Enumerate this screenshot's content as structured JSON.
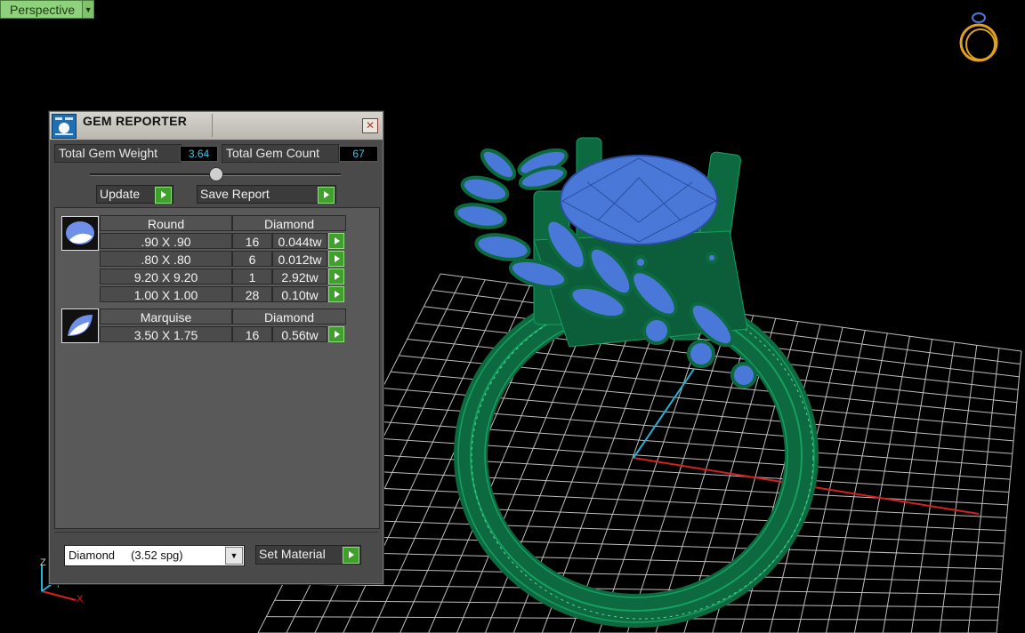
{
  "viewport": {
    "view_label": "Perspective",
    "axis_labels": {
      "z": "Z",
      "y": "Y",
      "x": "X"
    }
  },
  "panel": {
    "title": "GEM REPORTER",
    "total_weight_label": "Total Gem Weight",
    "total_weight_value": "3.64",
    "total_count_label": "Total Gem Count",
    "total_count_value": "67",
    "update_label": "Update",
    "save_report_label": "Save Report",
    "groups": [
      {
        "shape": "Round",
        "material": "Diamond",
        "rows": [
          {
            "size": ".90 X .90",
            "count": "16",
            "weight": "0.044tw"
          },
          {
            "size": ".80 X .80",
            "count": "6",
            "weight": "0.012tw"
          },
          {
            "size": "9.20 X 9.20",
            "count": "1",
            "weight": "2.92tw"
          },
          {
            "size": "1.00 X 1.00",
            "count": "28",
            "weight": "0.10tw"
          }
        ]
      },
      {
        "shape": "Marquise",
        "material": "Diamond",
        "rows": [
          {
            "size": "3.50 X 1.75",
            "count": "16",
            "weight": "0.56tw"
          }
        ]
      }
    ],
    "material_select_value": "Diamond     (3.52 spg)",
    "set_material_label": "Set Material"
  },
  "colors": {
    "ring_green": "#0f7a4a",
    "gem_blue": "#4a78d8",
    "grid": "#c8c8c8",
    "axis_red": "#d62020",
    "axis_cyan": "#22b4d6",
    "value_cyan": "#3ec6e8",
    "button_green": "#3fa12c"
  },
  "icons": [
    "ring-thumbnail-icon",
    "gem-reporter-icon",
    "close-icon",
    "play-arrow-icon",
    "round-gem-icon",
    "marquise-gem-icon",
    "dropdown-arrow-icon"
  ]
}
